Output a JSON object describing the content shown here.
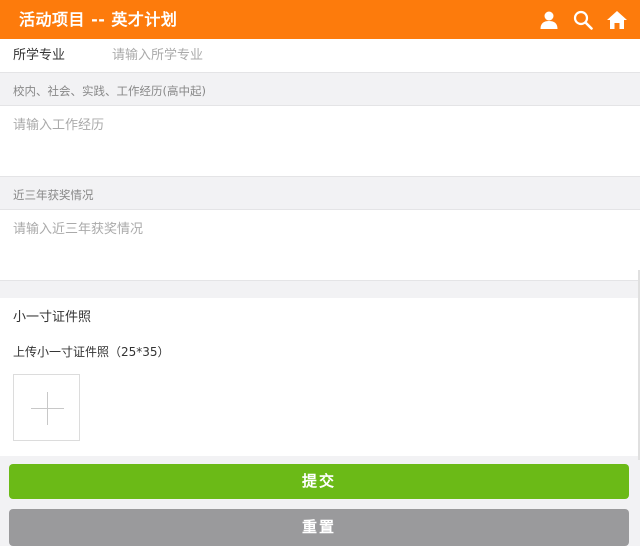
{
  "header": {
    "title": "活动项目 -- 英才计划",
    "icons": [
      "user-icon",
      "search-icon",
      "home-icon"
    ],
    "bg_color": "#fd7b0c"
  },
  "form": {
    "major": {
      "label": "所学专业",
      "placeholder": "请输入所学专业"
    },
    "experience": {
      "label": "校内、社会、实践、工作经历(高中起)",
      "placeholder": "请输入工作经历"
    },
    "awards": {
      "label": "近三年获奖情况",
      "placeholder": "请输入近三年获奖情况"
    },
    "photo": {
      "title": "小一寸证件照",
      "hint": "上传小一寸证件照（25*35）"
    }
  },
  "buttons": {
    "submit": "提交",
    "reset": "重置",
    "submit_color": "#6bba17",
    "reset_color": "#9a9a9c"
  }
}
